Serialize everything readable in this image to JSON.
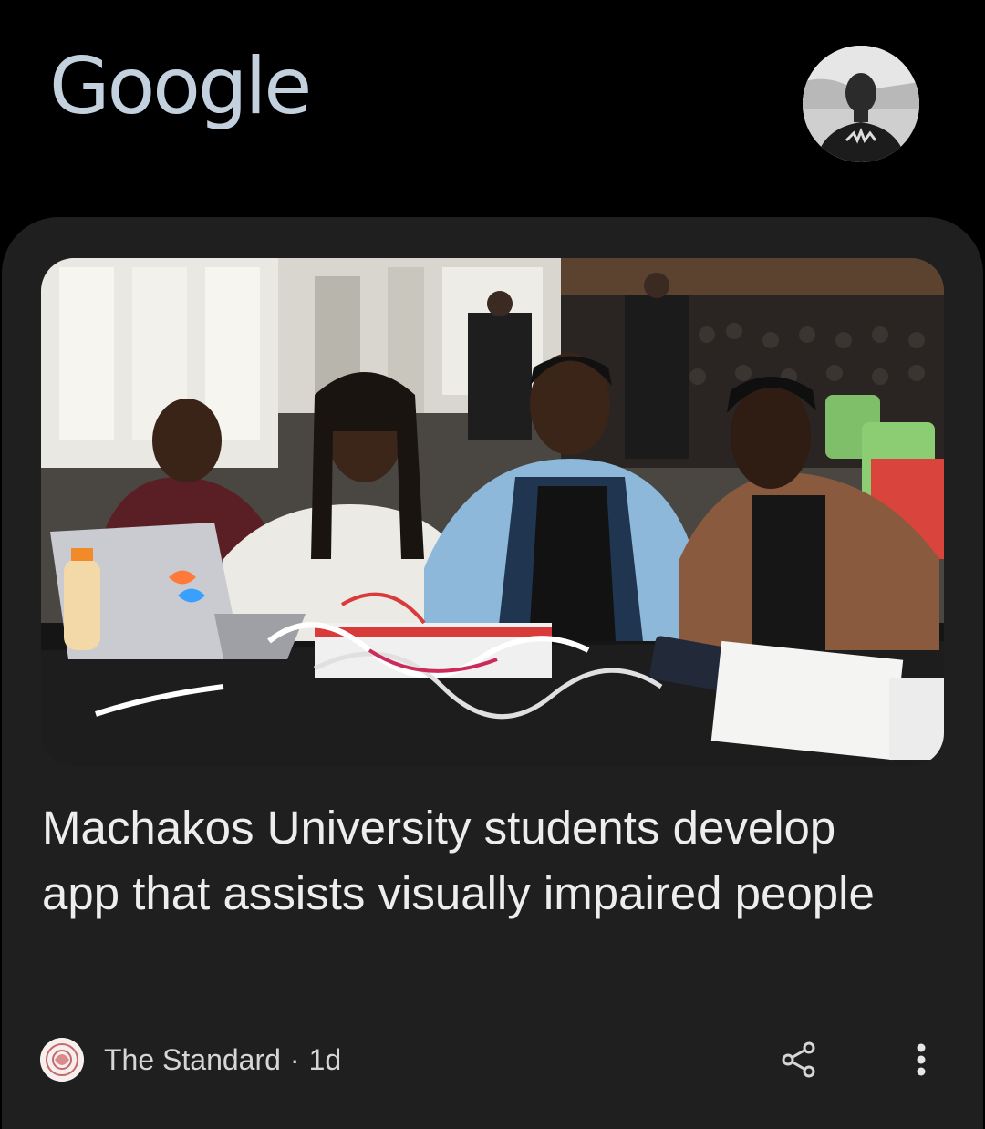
{
  "header": {
    "logo_text": "Google",
    "logo_color": "#c3d1df",
    "avatar_icon": "profile-avatar"
  },
  "card": {
    "background": "#1f1f1f",
    "image_icon": "news-photo",
    "headline": "Machakos University students develop app that assists visually impaired people",
    "source": {
      "name": "The Standard",
      "separator": "·",
      "age": "1d",
      "logo_icon": "source-logo"
    },
    "actions": {
      "share_icon": "share-icon",
      "more_icon": "more-vert-icon"
    }
  }
}
